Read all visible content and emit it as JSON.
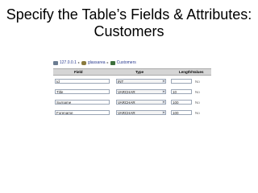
{
  "slide": {
    "title": "Specify the Table’s Fields & Attributes: Customers"
  },
  "breadcrumb": {
    "server": "127.0.0.1",
    "database": "glassarea",
    "table": "Customers",
    "separator": "▸"
  },
  "columns": {
    "field": "Field",
    "type": "Type",
    "length": "Length/Values"
  },
  "rows": [
    {
      "field": "Id",
      "type": "INT",
      "length": "",
      "attr": "No"
    },
    {
      "field": "Title",
      "type": "VARCHAR",
      "length": "10",
      "attr": "No"
    },
    {
      "field": "Surname",
      "type": "VARCHAR",
      "length": "100",
      "attr": "No"
    },
    {
      "field": "Forename",
      "type": "VARCHAR",
      "length": "100",
      "attr": "No"
    }
  ]
}
